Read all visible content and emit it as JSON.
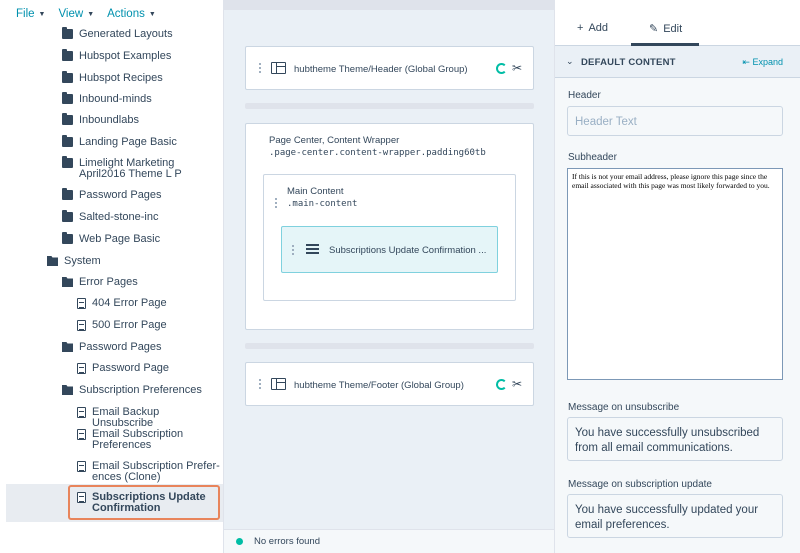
{
  "menu": {
    "file": "File",
    "view": "View",
    "actions": "Actions"
  },
  "tree": {
    "items": [
      {
        "label": "Generated Layouts",
        "type": "folder"
      },
      {
        "label": "Hubspot Examples",
        "type": "folder"
      },
      {
        "label": "Hubspot Recipes",
        "type": "folder"
      },
      {
        "label": "Inbound-minds",
        "type": "folder"
      },
      {
        "label": "Inboundlabs",
        "type": "folder"
      },
      {
        "label": "Landing Page Basic",
        "type": "folder"
      },
      {
        "label": "Limelight Marketing April2016 Theme L P",
        "line1": "Limelight Marketing",
        "line2": "April2016 Theme L P",
        "type": "folder"
      },
      {
        "label": "Password Pages",
        "type": "folder"
      },
      {
        "label": "Salted-stone-inc",
        "type": "folder"
      },
      {
        "label": "Web Page Basic",
        "type": "folder"
      },
      {
        "label": "System",
        "type": "folder-open"
      },
      {
        "label": "Error Pages",
        "type": "folder-open"
      },
      {
        "label": "404 Error Page",
        "type": "file"
      },
      {
        "label": "500 Error Page",
        "type": "file"
      },
      {
        "label": "Password Pages",
        "type": "folder-open"
      },
      {
        "label": "Password Page",
        "type": "file"
      },
      {
        "label": "Subscription Preferences",
        "type": "folder-open"
      },
      {
        "label": "Email Backup Unsubscribe",
        "type": "file"
      },
      {
        "label": "Email Subscription Preferences",
        "line1": "Email Subscription",
        "line2": "Preferences",
        "type": "file"
      },
      {
        "label": "Email Subscription Preferences (Clone)",
        "line1": "Email Subscription Prefer-",
        "line2": "ences (Clone)",
        "type": "file"
      },
      {
        "label": "Subscriptions Update Confirmation",
        "line1": "Subscriptions Update",
        "line2": "Confirmation",
        "type": "file",
        "selected": true
      }
    ]
  },
  "canvas": {
    "header_module": "hubtheme Theme/Header (Global Group)",
    "wrapper_title": "Page Center, Content Wrapper",
    "wrapper_class": ".page-center.content-wrapper.padding60tb",
    "main_title": "Main Content",
    "main_class": ".main-content",
    "rich_module": "Subscriptions Update Confirmation ...",
    "footer_module": "hubtheme Theme/Footer (Global Group)",
    "status": "No errors found"
  },
  "panel": {
    "tab_add": "Add",
    "tab_edit": "Edit",
    "section": "DEFAULT CONTENT",
    "expand": "Expand",
    "header_label": "Header",
    "header_placeholder": "Header Text",
    "subheader_label": "Subheader",
    "subheader_value": "If this is not your email address, please ignore this page since the email associated with this page was most likely forwarded to you.",
    "unsub_label": "Message on unsubscribe",
    "unsub_value": "You have successfully unsubscribed from all email communications.",
    "update_label": "Message on subscription update",
    "update_value": "You have successfully updated your email preferences."
  },
  "colors": {
    "accent": "#0091ae",
    "text": "#33475b",
    "highlight": "#e8845b",
    "success": "#00bda5"
  }
}
